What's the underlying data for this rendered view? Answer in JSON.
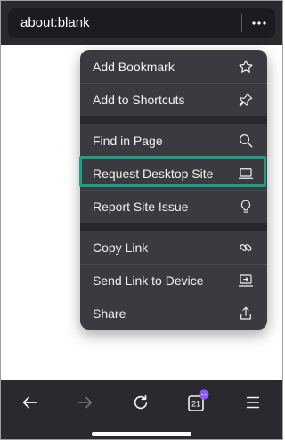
{
  "url_bar": {
    "text": "about:blank"
  },
  "menu": {
    "groups": [
      [
        {
          "label": "Add Bookmark",
          "icon": "star-icon"
        },
        {
          "label": "Add to Shortcuts",
          "icon": "pin-icon"
        }
      ],
      [
        {
          "label": "Find in Page",
          "icon": "search-icon"
        },
        {
          "label": "Request Desktop Site",
          "icon": "laptop-icon",
          "highlighted": true
        },
        {
          "label": "Report Site Issue",
          "icon": "lightbulb-icon"
        }
      ],
      [
        {
          "label": "Copy Link",
          "icon": "link-icon"
        },
        {
          "label": "Send Link to Device",
          "icon": "send-to-device-icon"
        },
        {
          "label": "Share",
          "icon": "share-icon"
        }
      ]
    ]
  },
  "toolbar": {
    "tab_count": "21",
    "icons": [
      "back-arrow-icon",
      "forward-arrow-icon",
      "reload-icon",
      "tabs-icon",
      "hamburger-menu-icon"
    ]
  },
  "colors": {
    "background_dark": "#2a2a2e",
    "menu_bg": "#3a3a40",
    "highlight_border": "#1f9e86",
    "badge_purple": "#9059ff"
  }
}
